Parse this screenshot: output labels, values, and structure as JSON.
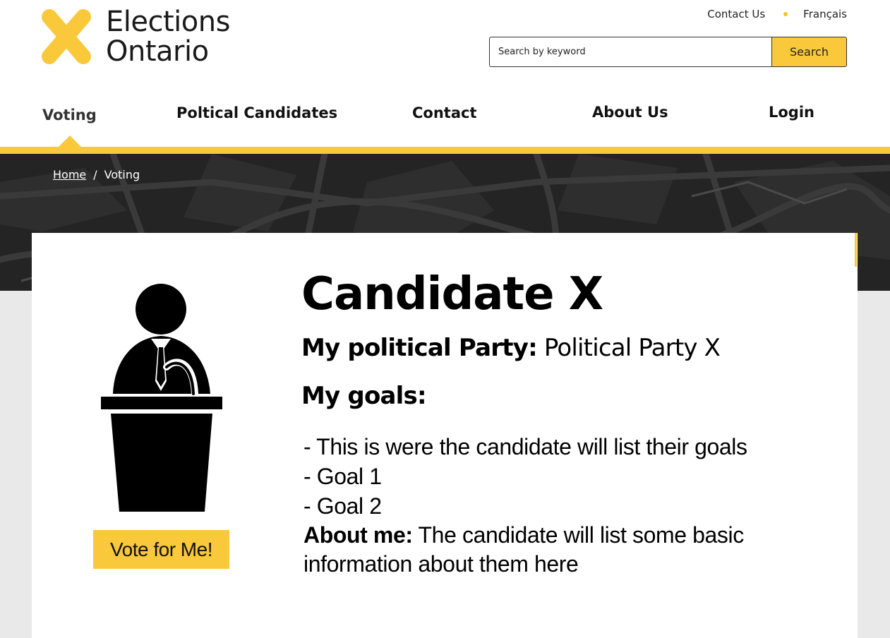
{
  "header": {
    "logo": {
      "line1": "Elections",
      "line2": "Ontario"
    },
    "utility_links": [
      {
        "label": "Contact Us"
      },
      {
        "label": "Français"
      }
    ],
    "search": {
      "placeholder": "Search by keyword",
      "button_label": "Search"
    }
  },
  "nav": {
    "items": [
      {
        "label": "Voting",
        "active": true
      },
      {
        "label": "Poltical Candidates"
      },
      {
        "label": "Contact"
      },
      {
        "label": "About Us"
      },
      {
        "label": "Login"
      }
    ]
  },
  "breadcrumb": {
    "home": "Home",
    "separator": "/",
    "current": "Voting"
  },
  "candidate": {
    "name": "Candidate X",
    "party_label": "My political Party:",
    "party_value": "Political Party X",
    "goals_heading": "My goals:",
    "goals": [
      "- This is were the candidate will list their goals",
      "- Goal 1",
      "- Goal 2"
    ],
    "about_label": "About me:",
    "about_text": "The candidate will list some basic information about them here",
    "vote_button": "Vote for Me!",
    "icon": "podium-speaker-icon"
  },
  "colors": {
    "accent": "#f9c93b",
    "hero": "#262626",
    "page_bg": "#e9e9e9"
  }
}
